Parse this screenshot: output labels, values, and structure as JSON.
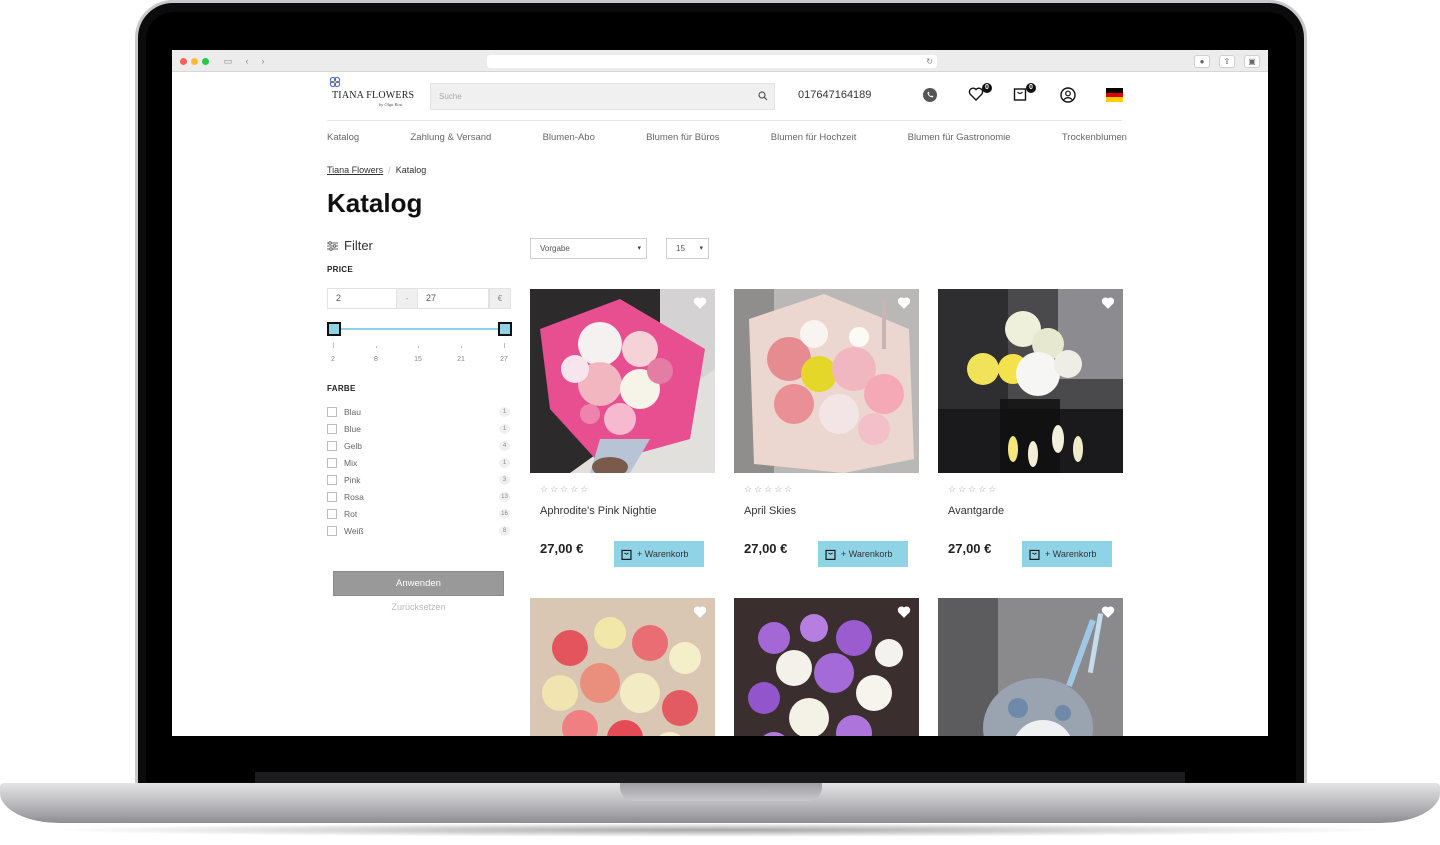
{
  "header": {
    "logo_name": "TIANA FLOWERS",
    "logo_sub": "by Olga Rost",
    "search_placeholder": "Suche",
    "phone": "017647164189",
    "wishlist_count": "0",
    "cart_count": "0"
  },
  "nav": [
    {
      "label": "Katalog"
    },
    {
      "label": "Zahlung & Versand"
    },
    {
      "label": "Blumen-Abo"
    },
    {
      "label": "Blumen für Büros"
    },
    {
      "label": "Blumen für Hochzeit"
    },
    {
      "label": "Blumen für Gastronomie"
    },
    {
      "label": "Trockenblumen"
    }
  ],
  "breadcrumb": {
    "home": "Tiana Flowers",
    "current": "Katalog"
  },
  "page_title": "Katalog",
  "filter": {
    "title": "Filter",
    "price_label": "PRICE",
    "price_min": "2",
    "price_max": "27",
    "currency": "€",
    "ticks": [
      "2",
      "8",
      "15",
      "21",
      "27"
    ],
    "color_label": "FARBE",
    "colors": [
      {
        "name": "Blau",
        "count": "1"
      },
      {
        "name": "Blue",
        "count": "1"
      },
      {
        "name": "Gelb",
        "count": "4"
      },
      {
        "name": "Mix",
        "count": "1"
      },
      {
        "name": "Pink",
        "count": "3"
      },
      {
        "name": "Rosa",
        "count": "13"
      },
      {
        "name": "Rot",
        "count": "16"
      },
      {
        "name": "Weiß",
        "count": "8"
      }
    ],
    "apply": "Anwenden",
    "reset": "Zurücksetzen"
  },
  "sorting": {
    "sort": "Vorgabe",
    "per_page": "15"
  },
  "products": [
    {
      "name": "Aphrodite's Pink Nightie",
      "price": "27,00 €",
      "cart": "+ Warenkorb"
    },
    {
      "name": "April Skies",
      "price": "27,00 €",
      "cart": "+ Warenkorb"
    },
    {
      "name": "Avantgarde",
      "price": "27,00 €",
      "cart": "+ Warenkorb"
    }
  ],
  "colors": {
    "accent": "#8fd3e6",
    "apply_button": "#999999"
  }
}
